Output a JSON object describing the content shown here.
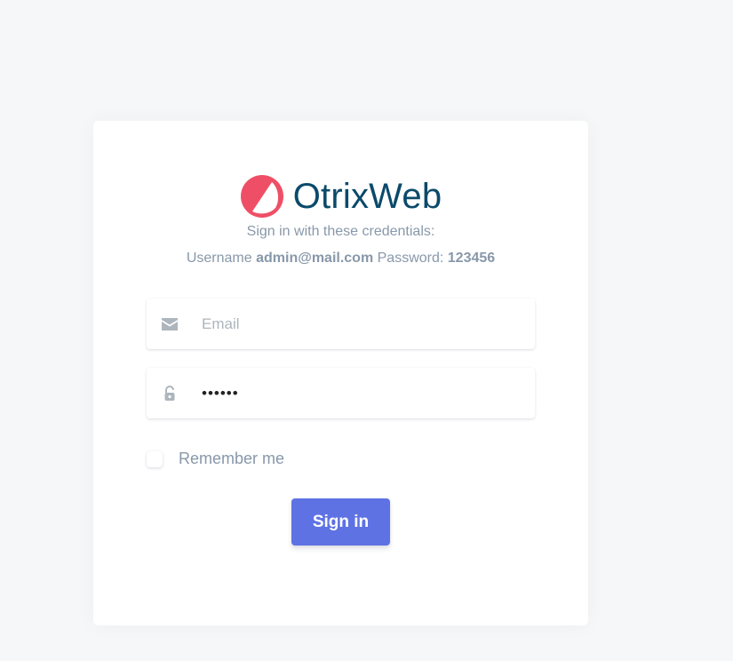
{
  "brand": {
    "name": "OtrixWeb",
    "logo_icon": "otrixweb-logo-icon",
    "logo_color": "#ef4f66",
    "name_color": "#0b4a6a"
  },
  "credentials_hint": {
    "line1": "Sign in with these credentials:",
    "username_label": "Username",
    "username_value": "admin@mail.com",
    "password_label": "Password:",
    "password_value": "123456"
  },
  "form": {
    "email": {
      "icon": "envelope-icon",
      "placeholder": "Email",
      "value": ""
    },
    "password": {
      "icon": "lock-icon",
      "masked_value": "••••••"
    },
    "remember": {
      "label": "Remember me",
      "checked": false
    },
    "submit_label": "Sign in",
    "accent_color": "#5e72e4"
  }
}
